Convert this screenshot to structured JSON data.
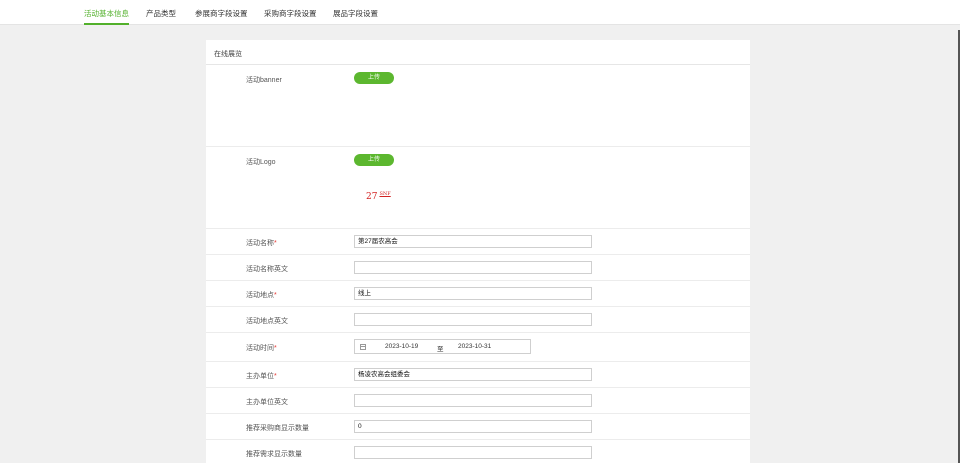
{
  "tabs": [
    {
      "label": "活动基本信息",
      "active": true
    },
    {
      "label": "产品类型",
      "active": false
    },
    {
      "label": "参展商字段设置",
      "active": false
    },
    {
      "label": "采购商字段设置",
      "active": false
    },
    {
      "label": "展品字段设置",
      "active": false
    }
  ],
  "panel": {
    "title": "在线展览"
  },
  "banner": {
    "label": "活动banner",
    "upload_label": "上传"
  },
  "logo": {
    "label": "活动Logo",
    "upload_label": "上传",
    "preview_number": "27",
    "preview_mark": "SNF"
  },
  "fields": {
    "name": {
      "label": "活动名称",
      "required_mark": "*",
      "value": "第27届农高会"
    },
    "name_en": {
      "label": "活动名称英文",
      "value": ""
    },
    "location": {
      "label": "活动地点",
      "required_mark": "*",
      "value": "线上"
    },
    "location_en": {
      "label": "活动地点英文",
      "value": ""
    },
    "time": {
      "label": "活动时间",
      "required_mark": "*",
      "start": "2023-10-19",
      "separator": "至",
      "end": "2023-10-31"
    },
    "host": {
      "label": "主办单位",
      "required_mark": "*",
      "value": "杨凌农高会组委会"
    },
    "host_en": {
      "label": "主办单位英文",
      "value": ""
    },
    "buyer_count": {
      "label": "推荐采购商显示数量",
      "value": "0"
    },
    "demand_count": {
      "label": "推荐需求显示数量",
      "value": ""
    }
  },
  "colors": {
    "accent": "#52b02b",
    "button": "#5cb72f",
    "required": "#e53935"
  }
}
